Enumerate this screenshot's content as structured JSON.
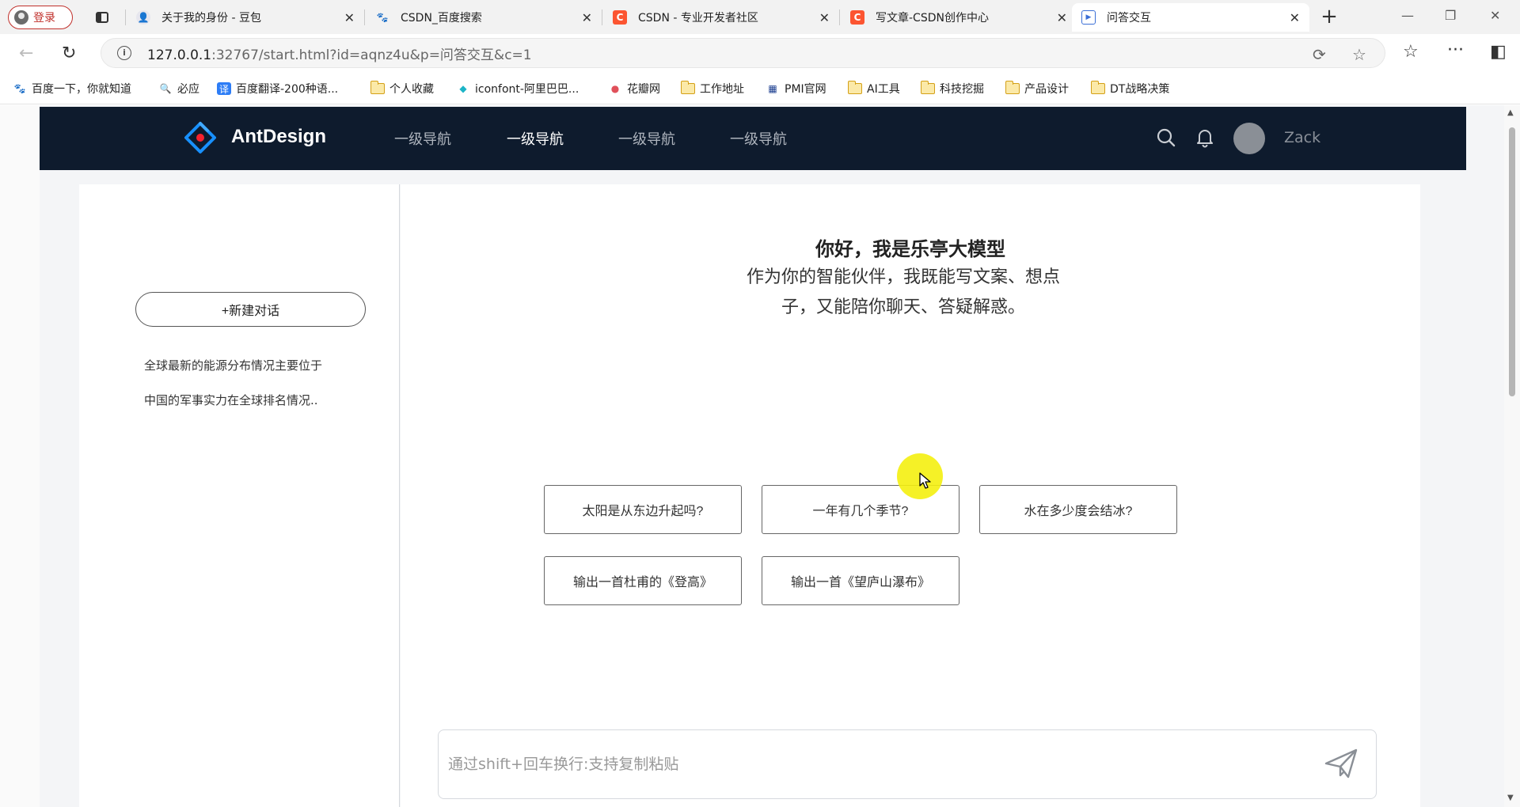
{
  "browser": {
    "profile_label": "登录",
    "tabs": [
      {
        "title": "关于我的身份 - 豆包",
        "icon": "doubao-icon"
      },
      {
        "title": "CSDN_百度搜索",
        "icon": "baidu-icon"
      },
      {
        "title": "CSDN - 专业开发者社区",
        "icon": "csdn-icon"
      },
      {
        "title": "写文章-CSDN创作中心",
        "icon": "csdn-icon"
      },
      {
        "title": "问答交互",
        "icon": "page-icon"
      }
    ],
    "url_host": "127.0.0.1",
    "url_rest": ":32767/start.html?id=aqnz4u&p=问答交互&c=1",
    "bookmarks": [
      "百度一下，你就知道",
      "必应",
      "百度翻译-200种语...",
      "个人收藏",
      "iconfont-阿里巴巴...",
      "花瓣网",
      "工作地址",
      "PMI官网",
      "AI工具",
      "科技挖掘",
      "产品设计",
      "DT战略决策"
    ]
  },
  "app": {
    "brand": "AntDesign",
    "nav": [
      "一级导航",
      "一级导航",
      "一级导航",
      "一级导航"
    ],
    "user_name": "Zack",
    "colors": {
      "header_bg": "#0e1b2d",
      "logo_blue": "#1890ff",
      "logo_red": "#f5222d"
    }
  },
  "sidebar": {
    "new_chat_label": "+新建对话",
    "history": [
      "全球最新的能源分布情况主要位于",
      "中国的军事实力在全球排名情况.."
    ]
  },
  "main": {
    "greeting_title": "你好，我是乐亭大模型",
    "greeting_sub": "作为你的智能伙伴，我既能写文案、想点子，又能陪你聊天、答疑解惑。",
    "questions": [
      "太阳是从东边升起吗?",
      "一年有几个季节?",
      "水在多少度会结冰?",
      "输出一首杜甫的《登高》",
      "输出一首《望庐山瀑布》"
    ],
    "input_placeholder": "通过shift+回车换行:支持复制粘贴"
  }
}
